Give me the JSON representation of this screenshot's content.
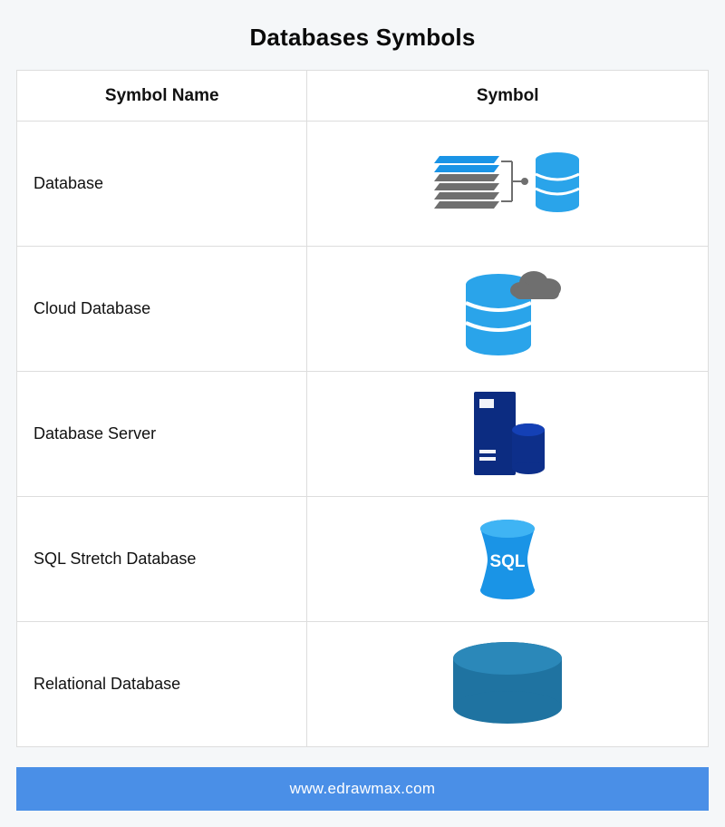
{
  "title": "Databases Symbols",
  "headers": {
    "name": "Symbol Name",
    "symbol": "Symbol"
  },
  "rows": [
    {
      "name": "Database",
      "icon": "database"
    },
    {
      "name": "Cloud Database",
      "icon": "cloud-db"
    },
    {
      "name": "Database Server",
      "icon": "db-server"
    },
    {
      "name": "SQL Stretch Database",
      "icon": "sql-stretch",
      "label": "SQL"
    },
    {
      "name": "Relational Database",
      "icon": "relational-db"
    }
  ],
  "footer": "www.edrawmax.com",
  "colors": {
    "lightBlue": "#2aa4ea",
    "brightBlue": "#1a94e6",
    "darkBlue": "#0d2f8a",
    "navy": "#0c2c81",
    "teal": "#1f73a1",
    "gray": "#6f6f6f",
    "lightGray": "#9a9a9a",
    "footerBlue": "#4a8fe7"
  }
}
